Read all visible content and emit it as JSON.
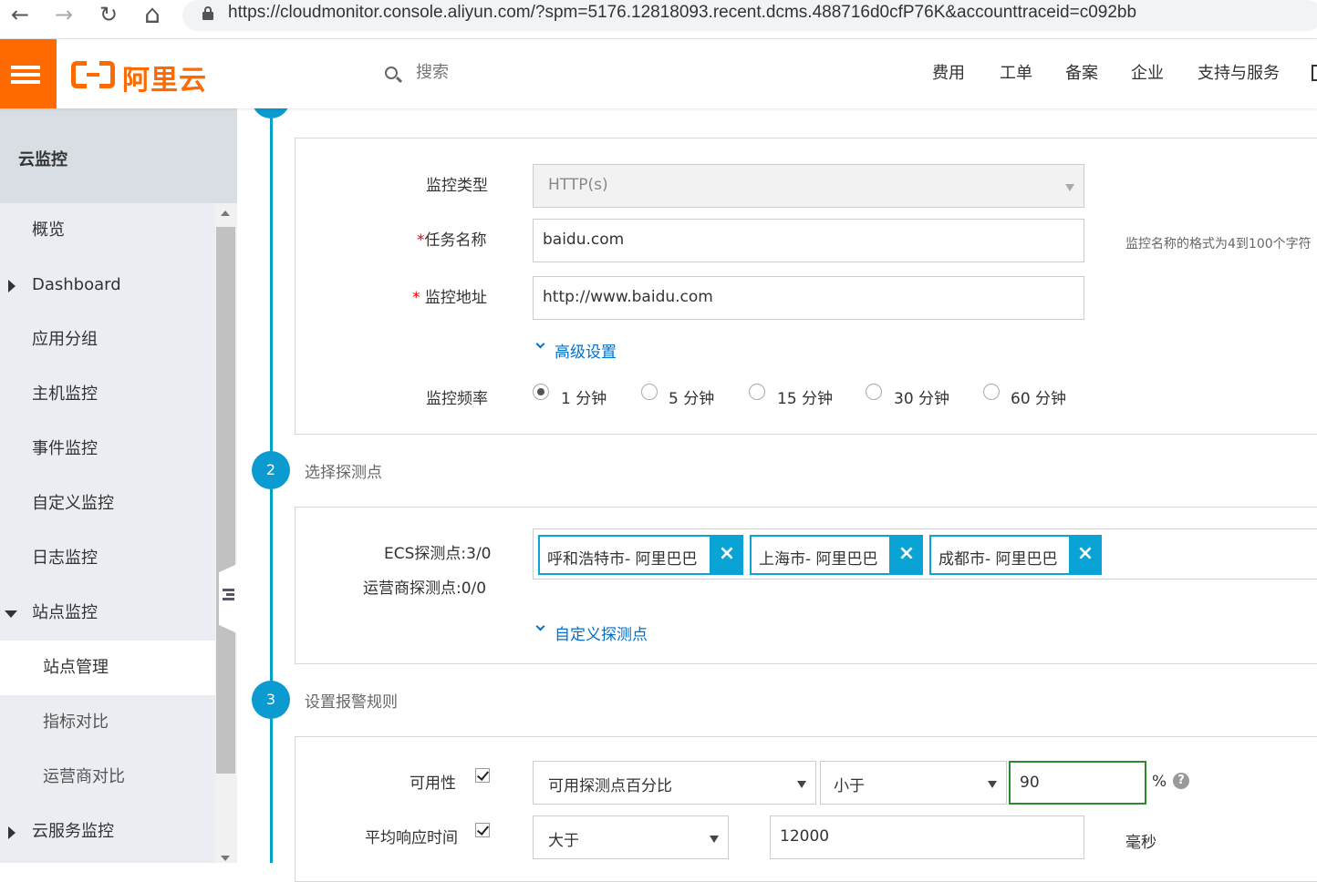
{
  "browser": {
    "url": "https://cloudmonitor.console.aliyun.com/?spm=5176.12818093.recent.dcms.488716d0cfP76K&accounttraceid=c092bb",
    "back_icon": "←",
    "forward_icon": "→",
    "reload_icon": "↻",
    "home_icon": "⌂"
  },
  "header": {
    "logo_text": "阿里云",
    "search_placeholder": "搜索",
    "nav": [
      "费用",
      "工单",
      "备案",
      "企业",
      "支持与服务"
    ],
    "brand_color": "#ff6a00"
  },
  "sidebar": {
    "title": "云监控",
    "items": [
      {
        "label": "概览"
      },
      {
        "label": "Dashboard"
      },
      {
        "label": "应用分组"
      },
      {
        "label": "主机监控"
      },
      {
        "label": "事件监控"
      },
      {
        "label": "自定义监控"
      },
      {
        "label": "日志监控"
      },
      {
        "label": "站点监控"
      },
      {
        "label": "站点管理"
      },
      {
        "label": "指标对比"
      },
      {
        "label": "运营商对比"
      },
      {
        "label": "云服务监控"
      }
    ]
  },
  "step1": {
    "monitor_type_label": "监控类型",
    "monitor_type_value": "HTTP(s)",
    "task_name_required": "*",
    "task_name_label": "任务名称",
    "task_name_value": "baidu.com",
    "task_name_hint": "监控名称的格式为4到100个字符",
    "address_required": "*",
    "address_label": "监控地址",
    "address_value": "http://www.baidu.com",
    "advanced_link": "高级设置",
    "frequency_label": "监控频率",
    "frequency_options": [
      "1 分钟",
      "5 分钟",
      "15 分钟",
      "30 分钟",
      "60 分钟"
    ],
    "frequency_selected": "1 分钟"
  },
  "step2": {
    "number": "2",
    "title": "选择探测点",
    "ecs_label": "ECS探测点:3/0",
    "isp_label": "运营商探测点:0/0",
    "tags": [
      "呼和浩特市- 阿里巴巴",
      "上海市- 阿里巴巴",
      "成都市- 阿里巴巴"
    ],
    "tag_close": "×",
    "custom_link": "自定义探测点",
    "accent_color": "#0aa3d6"
  },
  "step3": {
    "number": "3",
    "title": "设置报警规则",
    "availability_label": "可用性",
    "availability_metric": "可用探测点百分比",
    "availability_operator": "小于",
    "availability_value": "90",
    "availability_unit": "%",
    "help": "?",
    "response_label": "平均响应时间",
    "response_operator": "大于",
    "response_value": "12000",
    "response_unit": "毫秒"
  }
}
